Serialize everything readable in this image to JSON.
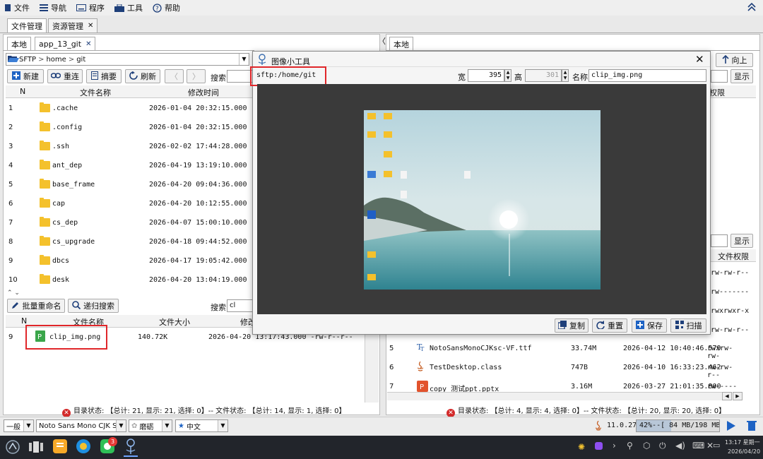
{
  "menu": {
    "file": "文件",
    "nav": "导航",
    "program": "程序",
    "tools": "工具",
    "help": "帮助"
  },
  "top_tabs": [
    "文件管理",
    "资源管理"
  ],
  "left": {
    "tabs": [
      "本地",
      "app_13_git"
    ],
    "path": {
      "protocol": "SFTP",
      "segments": [
        "home",
        "git"
      ]
    },
    "toolbar": {
      "new": "新建",
      "reconnect": "重连",
      "summary": "摘要",
      "refresh": "刷新",
      "search_label": "搜索"
    },
    "headers": {
      "n": "N",
      "name": "文件名称",
      "modified": "修改时间"
    },
    "rows": [
      {
        "n": "1",
        "name": ".cache",
        "time": "2026-01-04 20:32:15.000"
      },
      {
        "n": "2",
        "name": ".config",
        "time": "2026-01-04 20:32:15.000"
      },
      {
        "n": "3",
        "name": ".ssh",
        "time": "2026-02-02 17:44:28.000"
      },
      {
        "n": "4",
        "name": "ant_dep",
        "time": "2026-04-19 13:19:10.000"
      },
      {
        "n": "5",
        "name": "base_frame",
        "time": "2026-04-20 09:04:36.000"
      },
      {
        "n": "6",
        "name": "cap",
        "time": "2026-04-20 10:12:55.000"
      },
      {
        "n": "7",
        "name": "cs_dep",
        "time": "2026-04-07 15:00:10.000"
      },
      {
        "n": "8",
        "name": "cs_upgrade",
        "time": "2026-04-18 09:44:52.000"
      },
      {
        "n": "9",
        "name": "dbcs",
        "time": "2026-04-17 19:05:42.000"
      },
      {
        "n": "10",
        "name": "desk",
        "time": "2026-04-20 13:04:19.000"
      }
    ],
    "lower_toolbar": {
      "batch_rename": "批量重命名",
      "recursive_search": "递归搜索",
      "search_label": "搜索",
      "search_value": "cl"
    },
    "lower_headers": {
      "n": "N",
      "name": "文件名称",
      "size": "文件大小",
      "modified": "修改时"
    },
    "lower_row": {
      "n": "9",
      "name": "clip_img.png",
      "size": "140.72K",
      "time": "2026-04-20 13:17:43.000 -rw-r--r--"
    },
    "status": "目录状态: 【总计: 21, 显示: 21, 选择: 0】-- 文件状态: 【总计: 14, 显示: 1, 选择: 0】"
  },
  "right": {
    "tabs": [
      "本地"
    ],
    "up_button": "向上",
    "show_button": "显示",
    "perm_header": "权限",
    "show_button2": "显示",
    "perm_header2": "文件权限",
    "perm_values": [
      "rw-rw-r--",
      "rw-------",
      "rwxrwxr-x",
      "rw-rw-r--"
    ],
    "rows": [
      {
        "n": "5",
        "name": "NotoSansMonoCJKsc-VF.ttf",
        "size": "33.74M",
        "time": "2026-04-12 10:40:46.579",
        "perm": "rwxrw-rw-"
      },
      {
        "n": "6",
        "name": "TestDesktop.class",
        "size": "747B",
        "time": "2026-04-10 16:33:23.462",
        "perm": "rw-rw-r--"
      },
      {
        "n": "7",
        "name": "copy_测试ppt.pptx",
        "size": "3.16M",
        "time": "2026-03-27 21:01:35.800",
        "perm": "rw-------"
      }
    ],
    "status": "目录状态: 【总计: 4, 显示: 4, 选择: 0】-- 文件状态: 【总计: 20, 显示: 20, 选择: 0】"
  },
  "dialog": {
    "title": "图像小工具",
    "path": "sftp:/home/git",
    "width_label": "宽",
    "width_value": "395",
    "height_label": "高",
    "height_value": "301",
    "name_label": "名称",
    "name_value": "clip_img.png",
    "buttons": {
      "copy": "复制",
      "reset": "重置",
      "save": "保存",
      "scan": "扫描"
    }
  },
  "bottom_bar": {
    "mode": "一般",
    "font": "Noto Sans Mono CJK SC",
    "theme": "磨砺",
    "lang": "中文",
    "java": "11.0.27",
    "memory": "42%--[ 84 MB/198 MB ]"
  },
  "taskbar": {
    "badge": "3",
    "time": "13:17 星期一",
    "date": "2026/04/20"
  },
  "colors": {
    "accent": "#1e63c4",
    "highlight": "#e0262a",
    "folder": "#f4c12c"
  }
}
